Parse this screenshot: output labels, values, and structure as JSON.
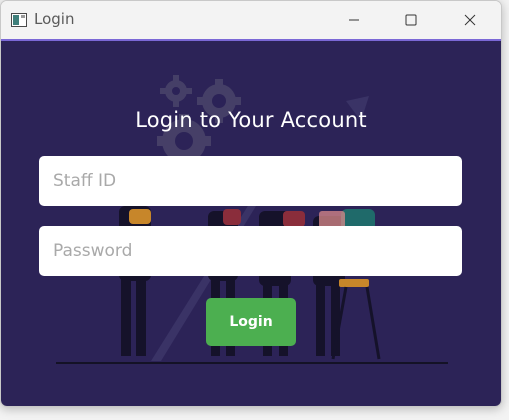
{
  "window": {
    "title": "Login",
    "icon": "app-window-icon",
    "controls": [
      "minimize-icon",
      "maximize-icon",
      "close-icon"
    ]
  },
  "login": {
    "heading": "Login to Your Account",
    "staff_id": {
      "value": "",
      "placeholder": "Staff ID"
    },
    "password": {
      "value": "",
      "placeholder": "Password"
    },
    "button_label": "Login"
  },
  "colors": {
    "background": "#2c2357",
    "accent_line": "#7b68d6",
    "button": "#4caf50",
    "button_text": "#ffffff",
    "heading_text": "#ffffff"
  }
}
